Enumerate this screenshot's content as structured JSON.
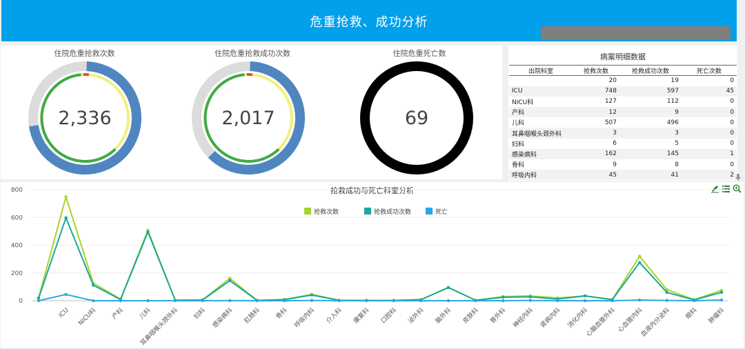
{
  "header": {
    "title": "危重抢救、成功分析"
  },
  "kpis": [
    {
      "title": "住院危重抢救次数",
      "value": "2,336",
      "progress": 0.72
    },
    {
      "title": "住院危重抢救成功次数",
      "value": "2,017",
      "progress": 0.62
    },
    {
      "title": "住院危重死亡数",
      "value": "69"
    }
  ],
  "table": {
    "title": "病案明细数据",
    "columns": [
      "出院科室",
      "抢救次数",
      "抢救成功次数",
      "死亡次数"
    ],
    "rows": [
      [
        "",
        "20",
        "19",
        "0"
      ],
      [
        "ICU",
        "748",
        "597",
        "45"
      ],
      [
        "NICU科",
        "127",
        "112",
        "0"
      ],
      [
        "产科",
        "12",
        "9",
        "0"
      ],
      [
        "儿科",
        "507",
        "496",
        "0"
      ],
      [
        "耳鼻咽喉头颈外科",
        "3",
        "3",
        "0"
      ],
      [
        "妇科",
        "6",
        "5",
        "0"
      ],
      [
        "感染病科",
        "162",
        "145",
        "1"
      ],
      [
        "骨科",
        "9",
        "8",
        "0"
      ],
      [
        "呼吸内科",
        "45",
        "41",
        "2"
      ]
    ]
  },
  "colors": {
    "header": "#00a0ea",
    "rescue": "#a8d32a",
    "success": "#19a89a",
    "death": "#2aa6e0",
    "gauge_blue": "#4f86c0"
  },
  "toolbox_icons": [
    "edit-icon",
    "data-view-icon",
    "zoom-icon"
  ],
  "chart_data": {
    "type": "line",
    "title": "抢救成功与死亡科室分析",
    "categories": [
      "",
      "ICU",
      "NICU科",
      "产科",
      "儿科",
      "耳鼻咽喉头颈外科",
      "妇科",
      "感染病科",
      "肛肠科",
      "骨科",
      "呼吸内科",
      "介入科",
      "康复科",
      "口腔科",
      "泌外科",
      "脑外科",
      "皮肤科",
      "普外科",
      "神经内科",
      "肾病内科",
      "消化内科",
      "心脑血管外科",
      "心血管内科",
      "血液内分泌科",
      "眼科",
      "肿瘤科"
    ],
    "series": [
      {
        "name": "抢救次数",
        "values": [
          20,
          748,
          127,
          12,
          507,
          3,
          6,
          162,
          2,
          9,
          45,
          3,
          2,
          2,
          8,
          95,
          3,
          30,
          35,
          20,
          35,
          8,
          320,
          80,
          8,
          75
        ]
      },
      {
        "name": "抢救成功次数",
        "values": [
          19,
          597,
          112,
          9,
          496,
          3,
          5,
          145,
          2,
          8,
          41,
          3,
          2,
          2,
          8,
          95,
          3,
          25,
          28,
          12,
          35,
          8,
          275,
          60,
          6,
          60
        ]
      },
      {
        "name": "死亡",
        "values": [
          0,
          45,
          0,
          0,
          0,
          0,
          0,
          1,
          0,
          0,
          2,
          0,
          0,
          0,
          0,
          0,
          0,
          0,
          2,
          0,
          0,
          0,
          5,
          2,
          0,
          5
        ]
      }
    ],
    "ylim": [
      0,
      800
    ],
    "yticks": [
      0,
      200,
      400,
      600,
      800
    ],
    "legend": "top-center",
    "grid": true
  }
}
